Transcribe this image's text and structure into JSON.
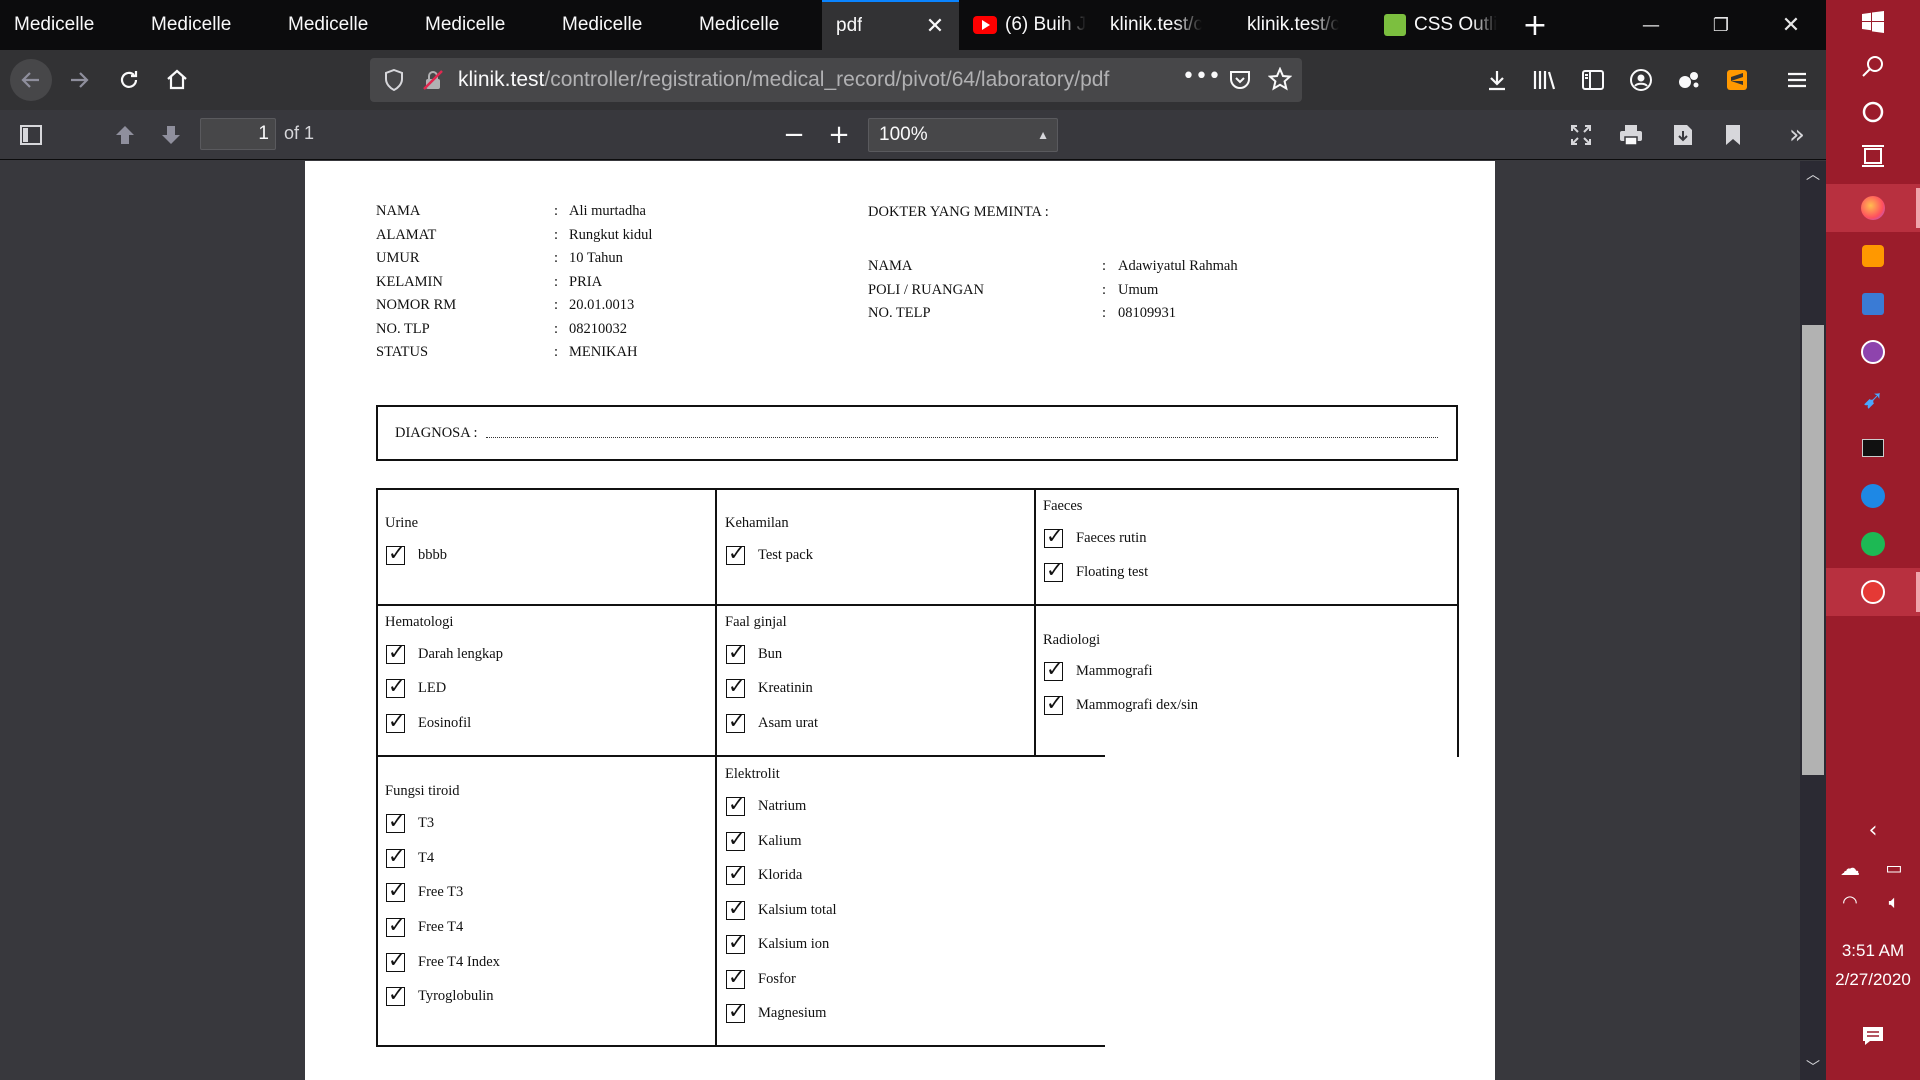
{
  "tabs": [
    {
      "label": "Medicelle",
      "active": false
    },
    {
      "label": "Medicelle",
      "active": false
    },
    {
      "label": "Medicelle",
      "active": false
    },
    {
      "label": "Medicelle",
      "active": false
    },
    {
      "label": "Medicelle",
      "active": false
    },
    {
      "label": "Medicelle",
      "active": false
    },
    {
      "label": "pdf",
      "active": true
    },
    {
      "label": "(6) Buih J",
      "icon": "youtube-icon"
    },
    {
      "label": "klinik.test/co"
    },
    {
      "label": "klinik.test/co"
    },
    {
      "label": "CSS Outli",
      "icon": "css-outline-icon"
    }
  ],
  "url": {
    "host": "klinik.test",
    "path": "/controller/registration/medical_record/pivot/64/laboratory/pdf"
  },
  "pdf_toolbar": {
    "page_number": "1",
    "page_total": "of 1",
    "zoom": "100%"
  },
  "patient": {
    "rows": [
      {
        "label": "NAMA",
        "value": "Ali murtadha"
      },
      {
        "label": "ALAMAT",
        "value": "Rungkut kidul"
      },
      {
        "label": "UMUR",
        "value": "10 Tahun"
      },
      {
        "label": "KELAMIN",
        "value": "PRIA"
      },
      {
        "label": "NOMOR RM",
        "value": "20.01.0013"
      },
      {
        "label": "NO. TLP",
        "value": "08210032"
      },
      {
        "label": "STATUS",
        "value": "MENIKAH"
      }
    ]
  },
  "doctor": {
    "heading": "DOKTER YANG MEMINTA :",
    "rows": [
      {
        "label": "NAMA",
        "value": "Adawiyatul Rahmah"
      },
      {
        "label": "POLI / RUANGAN",
        "value": "Umum"
      },
      {
        "label": "NO. TELP",
        "value": "08109931"
      }
    ]
  },
  "separator": ":",
  "diagnosa_label": "DIAGNOSA :",
  "categories": {
    "urine": {
      "title": "Urine",
      "items": [
        "bbbb"
      ]
    },
    "kehamilan": {
      "title": "Kehamilan",
      "items": [
        "Test pack"
      ]
    },
    "faeces": {
      "title": "Faeces",
      "items": [
        "Faeces rutin",
        "Floating test"
      ]
    },
    "hematologi": {
      "title": "Hematologi",
      "items": [
        "Darah lengkap",
        "LED",
        "Eosinofil"
      ]
    },
    "faal_ginjal": {
      "title": "Faal ginjal",
      "items": [
        "Bun",
        "Kreatinin",
        "Asam urat"
      ]
    },
    "radiologi": {
      "title": "Radiologi",
      "items": [
        "Mammografi",
        "Mammografi dex/sin"
      ]
    },
    "fungsi_tiroid": {
      "title": "Fungsi tiroid",
      "items": [
        "T3",
        "T4",
        "Free T3",
        "Free T4",
        "Free T4 Index",
        "Tyroglobulin"
      ]
    },
    "elektrolit": {
      "title": "Elektrolit",
      "items": [
        "Natrium",
        "Kalium",
        "Klorida",
        "Kalsium total",
        "Kalsium ion",
        "Fosfor",
        "Magnesium"
      ]
    }
  },
  "taskbar": {
    "time": "3:51 AM",
    "date": "2/27/2020"
  },
  "colors": {
    "taskbar": "#9b1c2b",
    "tab_accent": "#0a84ff",
    "chrome_dark": "#0c0c0d",
    "chrome": "#323234"
  }
}
